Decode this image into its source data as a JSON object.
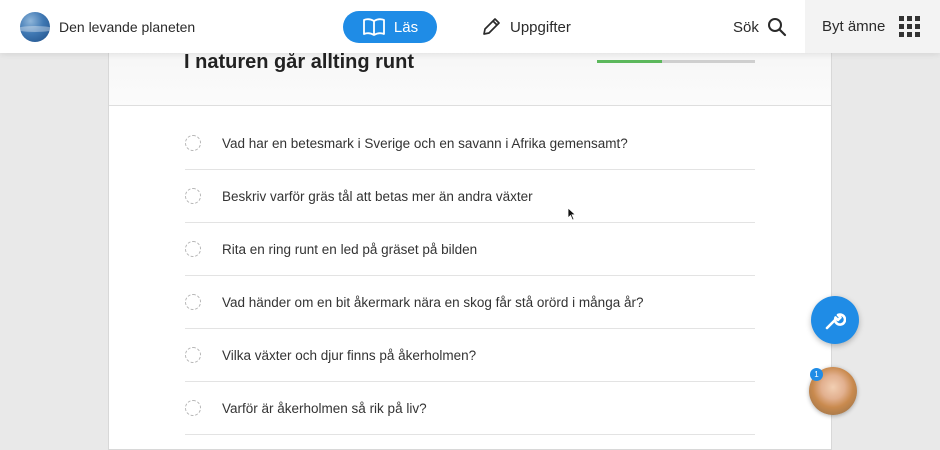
{
  "topbar": {
    "brand": "Den levande planeten",
    "read_label": "Läs",
    "tasks_label": "Uppgifter",
    "search_label": "Sök",
    "switch_label": "Byt ämne"
  },
  "card": {
    "title": "I naturen går allting runt",
    "progress": 0.41
  },
  "questions": [
    "Vad har en betesmark i Sverige och en savann i Afrika gemensamt?",
    "Beskriv varför  gräs tål att betas mer än andra växter",
    "Rita en ring runt en led på gräset på bilden",
    "Vad händer om en bit åkermark nära en skog får stå orörd i många år?",
    "Vilka växter och djur finns på åkerholmen?",
    "Varför är åkerholmen så rik på liv?"
  ],
  "help": {
    "badge_count": "1"
  },
  "icons": {
    "read": "book-icon",
    "tasks": "pencil-icon",
    "search": "search-icon",
    "switch": "grid-icon",
    "tools": "wrench-icon"
  },
  "colors": {
    "accent": "#1f8ce6",
    "progress": "#5cb85c"
  }
}
